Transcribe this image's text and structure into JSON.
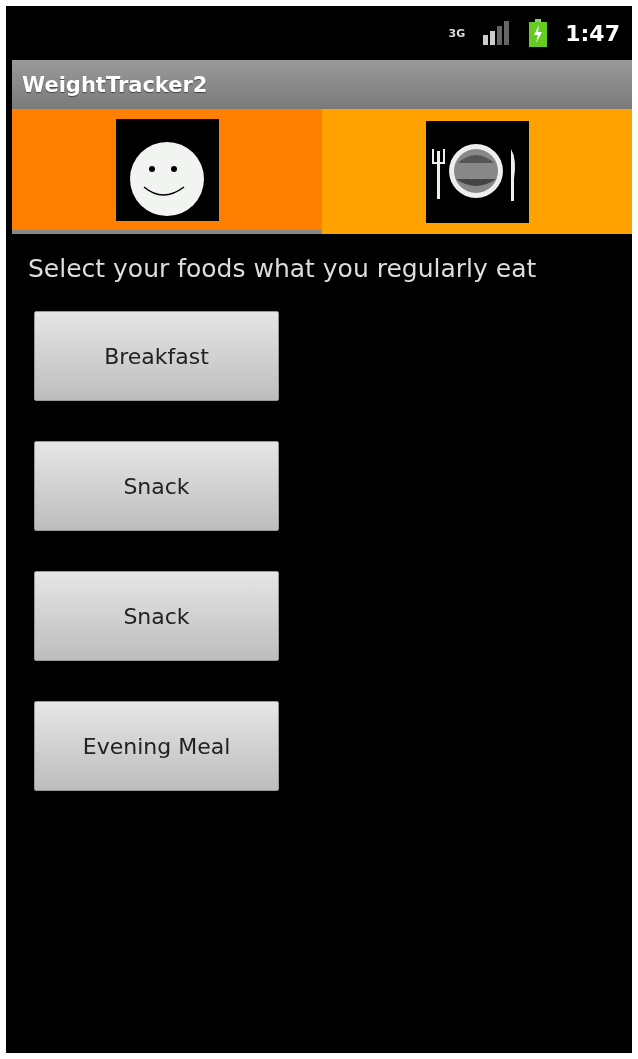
{
  "status_bar": {
    "network": "3G",
    "time": "1:47"
  },
  "window": {
    "title": "WeightTracker2"
  },
  "tabs": [
    {
      "kind": "smiley",
      "selected": true
    },
    {
      "kind": "plate",
      "selected": false
    }
  ],
  "prompt": "Select your foods what you regularly eat",
  "buttons": [
    "Breakfast",
    "Snack",
    "Snack",
    "Evening Meal"
  ]
}
